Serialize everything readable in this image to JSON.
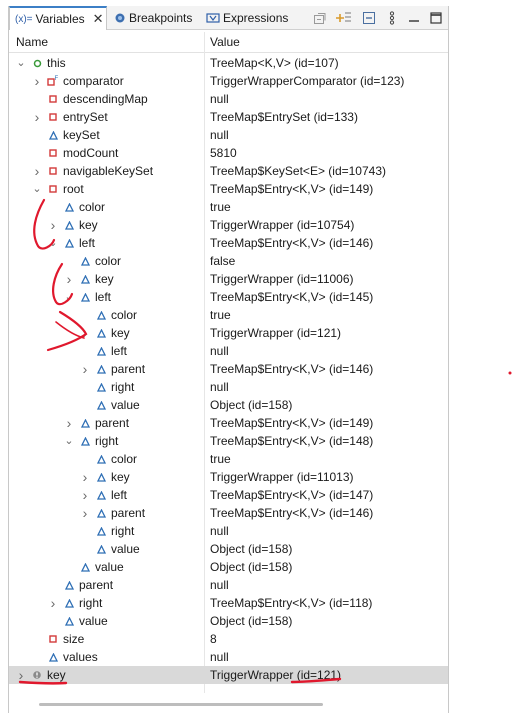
{
  "tabs": [
    {
      "label": "Variables",
      "icon": "variables-icon",
      "icon_text": "(x)=",
      "active": true
    },
    {
      "label": "Breakpoints",
      "icon": "breakpoints-icon",
      "active": false
    },
    {
      "label": "Expressions",
      "icon": "expressions-icon",
      "active": false
    }
  ],
  "toolbar": [
    "collapse-all-icon",
    "add-expression-icon",
    "minimize-icon",
    "view-menu-icon",
    "maximize-icon"
  ],
  "columns": {
    "name": "Name",
    "value": "Value"
  },
  "rows": [
    {
      "name": "this",
      "value": "TreeMap<K,V>  (id=107)",
      "depth": 0,
      "twisty": "expanded",
      "icon": "local"
    },
    {
      "name": "comparator",
      "value": "TriggerWrapperComparator  (id=123)",
      "depth": 1,
      "twisty": "collapsed",
      "icon": "private-final"
    },
    {
      "name": "descendingMap",
      "value": "null",
      "depth": 1,
      "twisty": "",
      "icon": "private"
    },
    {
      "name": "entrySet",
      "value": "TreeMap$EntrySet  (id=133)",
      "depth": 1,
      "twisty": "collapsed",
      "icon": "private"
    },
    {
      "name": "keySet",
      "value": "null",
      "depth": 1,
      "twisty": "",
      "icon": "default"
    },
    {
      "name": "modCount",
      "value": "5810",
      "depth": 1,
      "twisty": "",
      "icon": "private"
    },
    {
      "name": "navigableKeySet",
      "value": "TreeMap$KeySet<E>  (id=10743)",
      "depth": 1,
      "twisty": "collapsed",
      "icon": "private"
    },
    {
      "name": "root",
      "value": "TreeMap$Entry<K,V>  (id=149)",
      "depth": 1,
      "twisty": "expanded",
      "icon": "private"
    },
    {
      "name": "color",
      "value": "true",
      "depth": 2,
      "twisty": "",
      "icon": "default"
    },
    {
      "name": "key",
      "value": "TriggerWrapper  (id=10754)",
      "depth": 2,
      "twisty": "collapsed",
      "icon": "default"
    },
    {
      "name": "left",
      "value": "TreeMap$Entry<K,V>  (id=146)",
      "depth": 2,
      "twisty": "expanded",
      "icon": "default"
    },
    {
      "name": "color",
      "value": "false",
      "depth": 3,
      "twisty": "",
      "icon": "default"
    },
    {
      "name": "key",
      "value": "TriggerWrapper  (id=11006)",
      "depth": 3,
      "twisty": "collapsed",
      "icon": "default"
    },
    {
      "name": "left",
      "value": "TreeMap$Entry<K,V>  (id=145)",
      "depth": 3,
      "twisty": "expanded",
      "icon": "default"
    },
    {
      "name": "color",
      "value": "true",
      "depth": 4,
      "twisty": "",
      "icon": "default"
    },
    {
      "name": "key",
      "value": "TriggerWrapper  (id=121)",
      "depth": 4,
      "twisty": "collapsed",
      "icon": "default"
    },
    {
      "name": "left",
      "value": "null",
      "depth": 4,
      "twisty": "",
      "icon": "default"
    },
    {
      "name": "parent",
      "value": "TreeMap$Entry<K,V>  (id=146)",
      "depth": 4,
      "twisty": "collapsed",
      "icon": "default"
    },
    {
      "name": "right",
      "value": "null",
      "depth": 4,
      "twisty": "",
      "icon": "default"
    },
    {
      "name": "value",
      "value": "Object  (id=158)",
      "depth": 4,
      "twisty": "",
      "icon": "default"
    },
    {
      "name": "parent",
      "value": "TreeMap$Entry<K,V>  (id=149)",
      "depth": 3,
      "twisty": "collapsed",
      "icon": "default"
    },
    {
      "name": "right",
      "value": "TreeMap$Entry<K,V>  (id=148)",
      "depth": 3,
      "twisty": "expanded",
      "icon": "default"
    },
    {
      "name": "color",
      "value": "true",
      "depth": 4,
      "twisty": "",
      "icon": "default"
    },
    {
      "name": "key",
      "value": "TriggerWrapper  (id=11013)",
      "depth": 4,
      "twisty": "collapsed",
      "icon": "default"
    },
    {
      "name": "left",
      "value": "TreeMap$Entry<K,V>  (id=147)",
      "depth": 4,
      "twisty": "collapsed",
      "icon": "default"
    },
    {
      "name": "parent",
      "value": "TreeMap$Entry<K,V>  (id=146)",
      "depth": 4,
      "twisty": "collapsed",
      "icon": "default"
    },
    {
      "name": "right",
      "value": "null",
      "depth": 4,
      "twisty": "",
      "icon": "default"
    },
    {
      "name": "value",
      "value": "Object  (id=158)",
      "depth": 4,
      "twisty": "",
      "icon": "default"
    },
    {
      "name": "value",
      "value": "Object  (id=158)",
      "depth": 3,
      "twisty": "",
      "icon": "default"
    },
    {
      "name": "parent",
      "value": "null",
      "depth": 2,
      "twisty": "",
      "icon": "default"
    },
    {
      "name": "right",
      "value": "TreeMap$Entry<K,V>  (id=118)",
      "depth": 2,
      "twisty": "collapsed",
      "icon": "default"
    },
    {
      "name": "value",
      "value": "Object  (id=158)",
      "depth": 2,
      "twisty": "",
      "icon": "default"
    },
    {
      "name": "size",
      "value": "8",
      "depth": 1,
      "twisty": "",
      "icon": "private"
    },
    {
      "name": "values",
      "value": "null",
      "depth": 1,
      "twisty": "",
      "icon": "default"
    },
    {
      "name": "key",
      "value": "TriggerWrapper  (id=121)",
      "depth": 0,
      "twisty": "collapsed",
      "icon": "local-stale",
      "selected": true
    }
  ],
  "colors": {
    "accent": "#3c7fc6",
    "private_icon": "#d23a3a",
    "default_icon": "#2f6fb5",
    "local_icon": "#3a9a3a",
    "annotation": "#e0182d",
    "selection": "#d9d9d9"
  }
}
